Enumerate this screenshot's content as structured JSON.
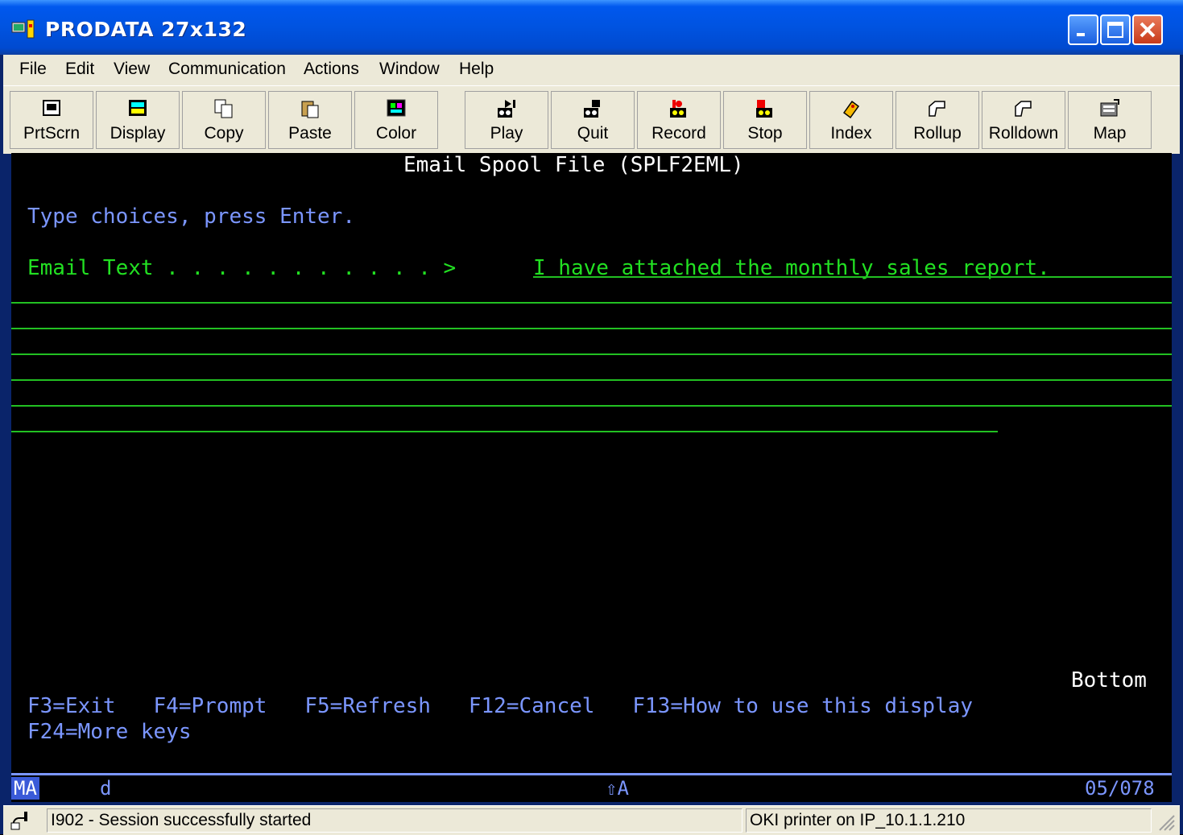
{
  "window": {
    "title": "PRODATA 27x132"
  },
  "menu": [
    "File",
    "Edit",
    "View",
    "Communication",
    "Actions",
    "Window",
    "Help"
  ],
  "toolbar": [
    {
      "label": "PrtScrn",
      "icon": "printscreen-icon"
    },
    {
      "label": "Display",
      "icon": "display-icon"
    },
    {
      "label": "Copy",
      "icon": "copy-icon"
    },
    {
      "label": "Paste",
      "icon": "paste-icon"
    },
    {
      "label": "Color",
      "icon": "color-icon"
    },
    {
      "label": "Play",
      "icon": "play-macro-icon"
    },
    {
      "label": "Quit",
      "icon": "quit-macro-icon"
    },
    {
      "label": "Record",
      "icon": "record-macro-icon"
    },
    {
      "label": "Stop",
      "icon": "stop-macro-icon"
    },
    {
      "label": "Index",
      "icon": "index-icon"
    },
    {
      "label": "Rollup",
      "icon": "rollup-icon"
    },
    {
      "label": "Rolldown",
      "icon": "rolldown-icon"
    },
    {
      "label": "Map",
      "icon": "map-icon"
    }
  ],
  "screen": {
    "heading": "Email Spool File (SPLF2EML)",
    "instruction": "Type choices, press Enter.",
    "field_label": "Email Text . . . . . . . . . . . > ",
    "field_value": "I have attached the monthly sales report.",
    "bottom": "Bottom",
    "fkeys_line1": "F3=Exit   F4=Prompt   F5=Refresh   F12=Cancel   F13=How to use this display",
    "fkeys_line2": "F24=More keys"
  },
  "oia": {
    "mode": "MA",
    "indicator": "d",
    "shift": "⇧A",
    "cursor": "05/078"
  },
  "statusbar": {
    "message": "I902 - Session successfully started",
    "printer": "OKI printer on IP_10.1.1.210"
  },
  "colors": {
    "screen_bg": "#000000",
    "heading": "#ffffff",
    "instruction": "#7b96ff",
    "field": "#22e022"
  }
}
